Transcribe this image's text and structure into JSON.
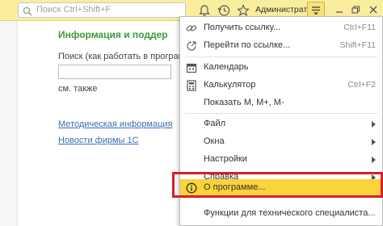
{
  "topbar": {
    "search_placeholder": "Поиск Ctrl+Shift+F",
    "user_name": "Администратор",
    "icons": [
      "search-icon",
      "bell-icon",
      "history-icon",
      "star-icon",
      "main-menu-icon",
      "restore-window-icon",
      "close-icon"
    ]
  },
  "page": {
    "heading": "Информация и поддер",
    "search_label": "Поиск (как работать в програм",
    "see_also": "см. также",
    "links": [
      "Методическая информация",
      "Новости фирмы 1С"
    ]
  },
  "menu": {
    "get_link": {
      "label": "Получить ссылку...",
      "shortcut": "Ctrl+F11"
    },
    "goto_link": {
      "label": "Перейти по ссылке...",
      "shortcut": "Shift+F11"
    },
    "calendar": {
      "label": "Календарь"
    },
    "calculator": {
      "label": "Калькулятор",
      "shortcut": "Ctrl+F2"
    },
    "show_m": {
      "label": "Показать М, М+, М-"
    },
    "file": {
      "label": "Файл"
    },
    "windows": {
      "label": "Окна"
    },
    "settings": {
      "label": "Настройки"
    },
    "help": {
      "label": "Справка"
    },
    "about": {
      "label": "О программе..."
    },
    "tech": {
      "label": "Функции для технического специалиста..."
    }
  },
  "colors": {
    "topbar": "#fbed9e",
    "highlight": "#fbd33a",
    "highlight_frame": "#d61e29",
    "heading": "#3a9a3a",
    "link": "#3c6fb0"
  }
}
